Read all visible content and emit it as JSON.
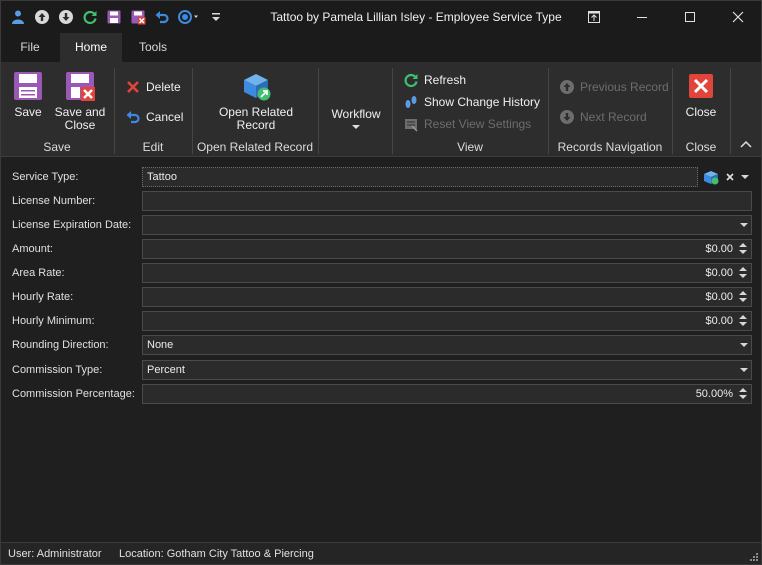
{
  "window": {
    "title": "Tattoo by Pamela Lillian Isley - Employee Service Type"
  },
  "quick_access": [
    "user-icon",
    "up-arrow-icon",
    "down-arrow-icon",
    "refresh-icon",
    "save-icon",
    "save-close-icon",
    "undo-icon",
    "workflow-icon",
    "customize-icon"
  ],
  "tabs": [
    {
      "label": "File"
    },
    {
      "label": "Home"
    },
    {
      "label": "Tools"
    }
  ],
  "ribbon": {
    "save": {
      "save_label": "Save",
      "save_close_label": "Save and Close",
      "group": "Save"
    },
    "edit": {
      "delete_label": "Delete",
      "cancel_label": "Cancel",
      "group": "Edit"
    },
    "open_related": {
      "button_label": "Open Related Record",
      "group": "Open Related Record"
    },
    "workflow": {
      "label": "Workflow"
    },
    "view": {
      "refresh_label": "Refresh",
      "history_label": "Show Change History",
      "reset_label": "Reset View Settings",
      "group": "View"
    },
    "navigation": {
      "previous_label": "Previous Record",
      "next_label": "Next Record",
      "group": "Records Navigation"
    },
    "close": {
      "label": "Close",
      "group": "Close"
    }
  },
  "form": {
    "service_type": {
      "label": "Service Type:",
      "value": "Tattoo"
    },
    "license_number": {
      "label": "License Number:",
      "value": ""
    },
    "license_expiration": {
      "label": "License Expiration Date:",
      "value": ""
    },
    "amount": {
      "label": "Amount:",
      "value": "$0.00"
    },
    "area_rate": {
      "label": "Area Rate:",
      "value": "$0.00"
    },
    "hourly_rate": {
      "label": "Hourly Rate:",
      "value": "$0.00"
    },
    "hourly_minimum": {
      "label": "Hourly Minimum:",
      "value": "$0.00"
    },
    "rounding_direction": {
      "label": "Rounding Direction:",
      "value": "None"
    },
    "commission_type": {
      "label": "Commission Type:",
      "value": "Percent"
    },
    "commission_percentage": {
      "label": "Commission Percentage:",
      "value": "50.00%"
    }
  },
  "status": {
    "user": "User: Administrator",
    "location": "Location: Gotham City Tattoo & Piercing"
  },
  "colors": {
    "accent_purple": "#9b59b6",
    "close_red": "#e0443a",
    "refresh_green": "#3fbf6f",
    "nav_blue": "#3d8be0"
  }
}
